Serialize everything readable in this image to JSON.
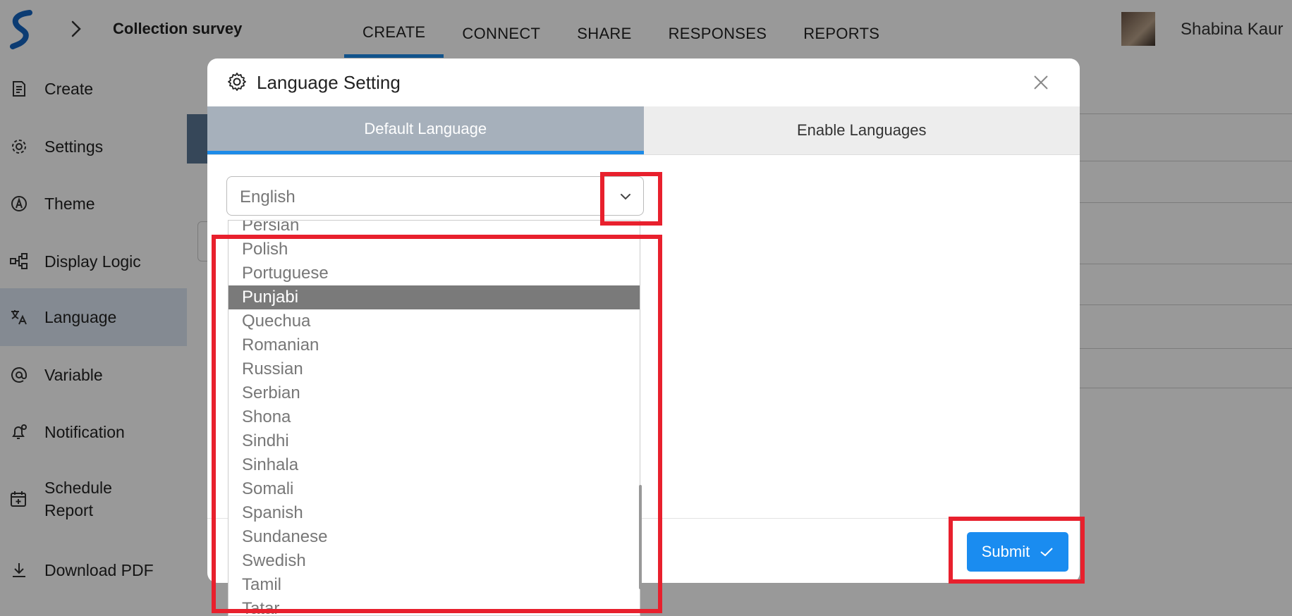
{
  "header": {
    "survey_title": "Collection survey",
    "tabs": [
      {
        "label": "CREATE",
        "active": true
      },
      {
        "label": "CONNECT",
        "active": false
      },
      {
        "label": "SHARE",
        "active": false
      },
      {
        "label": "RESPONSES",
        "active": false
      },
      {
        "label": "REPORTS",
        "active": false
      }
    ],
    "user_name": "Shabina Kaur"
  },
  "sidebar": {
    "items": [
      {
        "label": "Create",
        "icon": "document-edit-icon"
      },
      {
        "label": "Settings",
        "icon": "gear-icon"
      },
      {
        "label": "Theme",
        "icon": "palette-icon"
      },
      {
        "label": "Display Logic",
        "icon": "flow-logic-icon"
      },
      {
        "label": "Language",
        "icon": "translate-icon",
        "active": true
      },
      {
        "label": "Variable",
        "icon": "at-sign-icon"
      },
      {
        "label": "Notification",
        "icon": "bell-icon"
      },
      {
        "label": "Schedule\nReport",
        "icon": "calendar-add-icon"
      },
      {
        "label": "Download PDF",
        "icon": "download-icon"
      }
    ]
  },
  "modal": {
    "title": "Language Setting",
    "tabs": [
      {
        "label": "Default Language",
        "active": true
      },
      {
        "label": "Enable Languages",
        "active": false
      }
    ],
    "select": {
      "value": "English"
    },
    "options": [
      "Persian",
      "Polish",
      "Portuguese",
      "Punjabi",
      "Quechua",
      "Romanian",
      "Russian",
      "Serbian",
      "Shona",
      "Sindhi",
      "Sinhala",
      "Somali",
      "Spanish",
      "Sundanese",
      "Swedish",
      "Tamil",
      "Tatar"
    ],
    "highlighted_option": "Punjabi",
    "submit_label": "Submit"
  },
  "colors": {
    "accent": "#1d8be8",
    "highlight_box": "#e8202d",
    "selected_option": "#7a7a7a"
  }
}
